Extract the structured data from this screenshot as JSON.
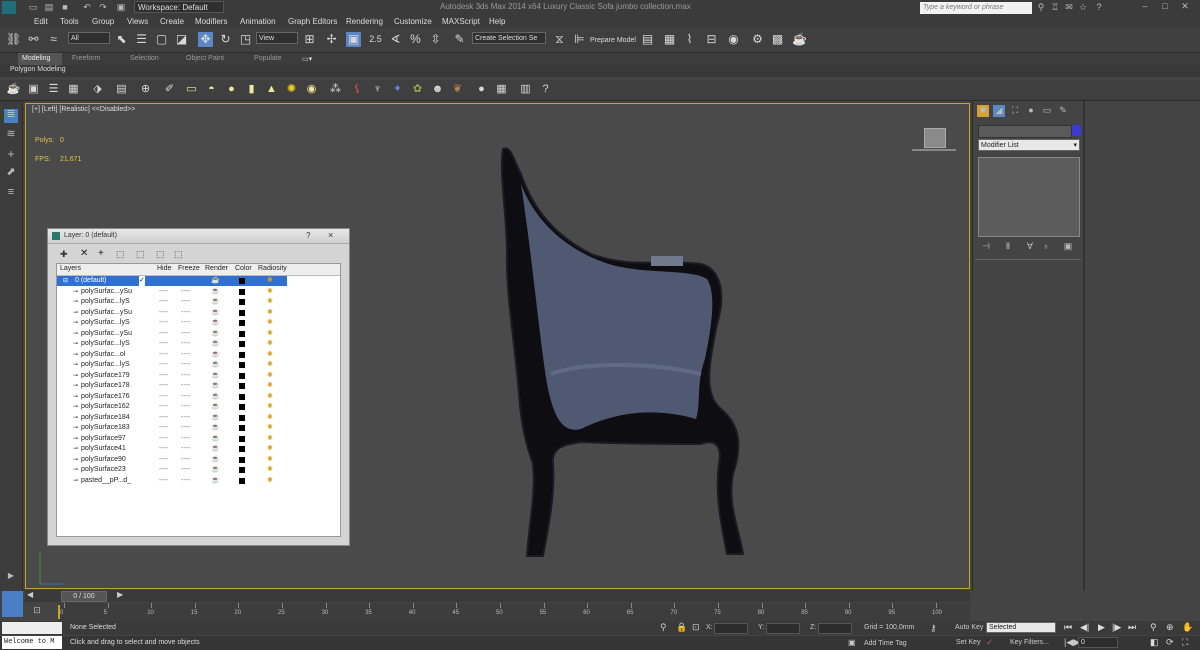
{
  "window": {
    "title": "Autodesk 3ds Max 2014 x64    Luxury Classic Sofa jumbo collection.max",
    "workspace": "Workspace: Default",
    "search_placeholder": "Type a keyword or phrase"
  },
  "menu": [
    "Edit",
    "Tools",
    "Group",
    "Views",
    "Create",
    "Modifiers",
    "Animation",
    "Graph Editors",
    "Rendering",
    "Customize",
    "MAXScript",
    "Help"
  ],
  "toolbar": {
    "filter": "All",
    "refcoord": "View",
    "selset": "Create Selection Se",
    "prepare": "Prepare Model"
  },
  "ribbon": {
    "tabs": [
      "Modeling",
      "Freeform",
      "Selection",
      "Object Paint",
      "Populate"
    ],
    "sub": "Polygon Modeling"
  },
  "viewport": {
    "label": "[+] [Left] [Realistic] <<Disabled>>",
    "polys_label": "Polys:",
    "polys_value": "0",
    "fps_label": "FPS:",
    "fps_value": "21,671"
  },
  "cmdpanel": {
    "modifier_list": "Modifier List"
  },
  "layer_dialog": {
    "title": "Layer: 0 (default)",
    "help": "?",
    "close": "×",
    "columns": [
      "Layers",
      "Hide",
      "Freeze",
      "Render",
      "Color",
      "Radiosity"
    ],
    "rows": [
      "0 (default)",
      "polySurfac...ySu",
      "polySurfac...lyS",
      "polySurfac...ySu",
      "polySurfac...lyS",
      "polySurfac...ySu",
      "polySurfac...lyS",
      "polySurfac...ol",
      "polySurfac...lyS",
      "polySurface179",
      "polySurface178",
      "polySurface176",
      "polySurface162",
      "polySurface184",
      "polySurface183",
      "polySurface97",
      "polySurface41",
      "polySurface90",
      "polySurface23",
      "pasted__pP...d_"
    ],
    "dash": "----"
  },
  "timeline": {
    "frame": "0 / 100",
    "ticks": [
      "0",
      "5",
      "10",
      "15",
      "20",
      "25",
      "30",
      "35",
      "40",
      "45",
      "50",
      "55",
      "60",
      "65",
      "70",
      "75",
      "80",
      "85",
      "90",
      "95",
      "100"
    ]
  },
  "status": {
    "listener": "Welcome to M",
    "selection": "None Selected",
    "prompt": "Click and drag to select and move objects",
    "x": "X:",
    "y": "Y:",
    "z": "Z:",
    "grid": "Grid = 100,0mm",
    "add_time_tag": "Add Time Tag",
    "autokey": "Auto Key",
    "autokey_value": "Selected",
    "setkey": "Set Key",
    "keyfilters": "Key Filters...",
    "frame_value": "0"
  },
  "colors": {
    "viewport_border": "#c9a227",
    "stat_yellow": "#e6c34a",
    "layer_select": "#3070d0",
    "modifier_swatch": "#3a3ad8"
  }
}
